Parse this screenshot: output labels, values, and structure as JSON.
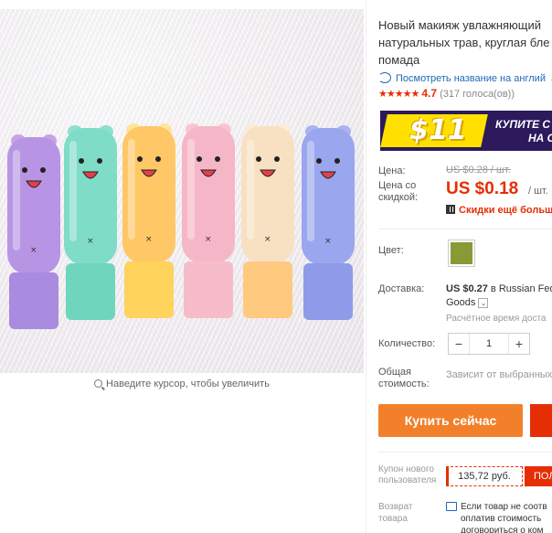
{
  "gallery": {
    "zoom_hint": "Наведите курсор, чтобы увеличить",
    "lipsticks": [
      {
        "cap": "#c9a2e6",
        "body": "#b795e4",
        "base": "#a98be0"
      },
      {
        "cap": "#8ee0cf",
        "body": "#7fdcc6",
        "base": "#6fd6bd"
      },
      {
        "cap": "#ffe59a",
        "body": "#ffc766",
        "base": "#ffd35c"
      },
      {
        "cap": "#f8c6d1",
        "body": "#f5b7c7",
        "base": "#f7bcc9"
      },
      {
        "cap": "#fbecd7",
        "body": "#f8e0c2",
        "base": "#ffc980"
      },
      {
        "cap": "#aab3f2",
        "body": "#9aa6ee",
        "base": "#8f9ae9"
      }
    ]
  },
  "product": {
    "title_line1": "Новый макияж увлажняющий",
    "title_line2": "натуральных трав, круглая бле",
    "title_line3": "помада",
    "translate_link": "Посмотреть название на англий",
    "stars": "★★★★★",
    "rating": "4.7",
    "votes": "(317 голоса(ов))",
    "banner_amount": "$11",
    "banner_cta_line1": "КУПИТЕ С",
    "banner_cta_line2": "НА С"
  },
  "price": {
    "label": "Цена:",
    "old": "US $0.28 / шт.",
    "discount_label_1": "Цена со",
    "discount_label_2": "скидкой:",
    "new": "US $0.18",
    "per_unit": "/ шт.",
    "qr_text": "Скидки ещё больше"
  },
  "options": {
    "color_label": "Цвет:",
    "color_swatch": "#879a36",
    "shipping_label": "Доставка:",
    "shipping_price": "US $0.27",
    "shipping_text": " в Russian Fed",
    "shipping_text2": "Goods",
    "shipping_time": "Расчётное время доста",
    "qty_label": "Количество:",
    "qty_value": "1",
    "qty_minus": "−",
    "qty_plus": "+",
    "total_label_1": "Общая",
    "total_label_2": "стоимость:",
    "total_value": "Зависит от выбранных"
  },
  "actions": {
    "buy_now": "Купить сейчас",
    "coupon_label_1": "Купон нового",
    "coupon_label_2": "пользователя",
    "coupon_value": "135,72 руб.",
    "coupon_btn": "ПОЛ",
    "return_label_1": "Возврат",
    "return_label_2": "товара",
    "return_text_1": "Если товар не соотв",
    "return_text_2": "оплатив стоимость",
    "return_text_3": "договориться о ком"
  }
}
